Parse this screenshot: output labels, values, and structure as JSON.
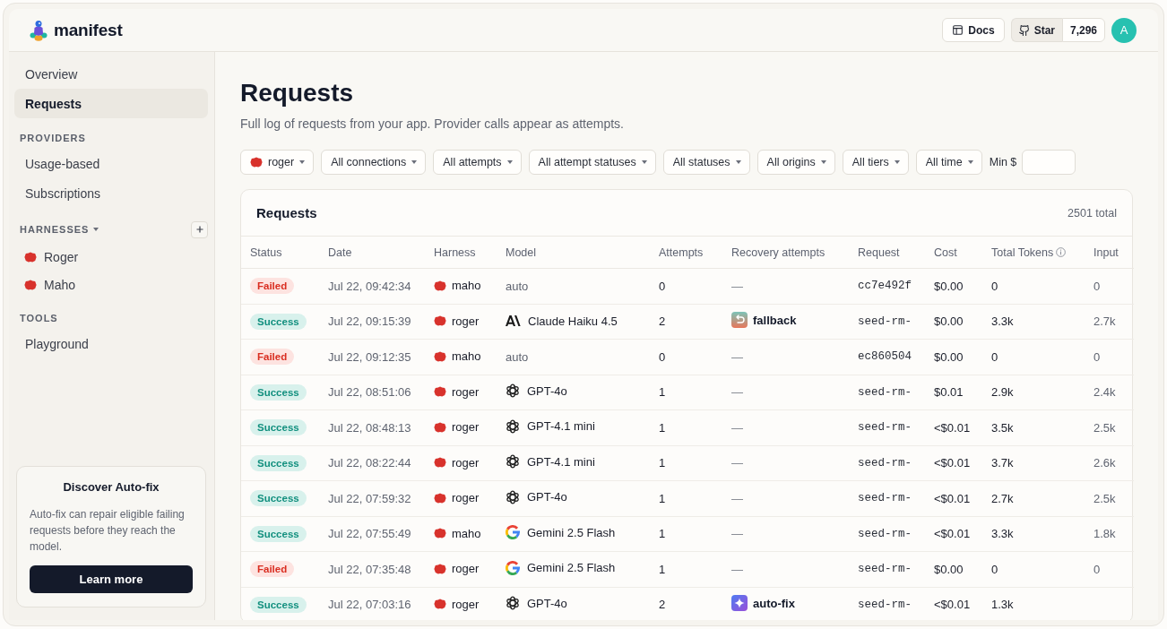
{
  "header": {
    "logo": "manifest",
    "docs": "Docs",
    "star": "Star",
    "star_count": "7,296",
    "avatar": "A"
  },
  "sidebar": {
    "nav": [
      {
        "label": "Overview",
        "selected": false
      },
      {
        "label": "Requests",
        "selected": true
      }
    ],
    "sections": [
      {
        "title": "PROVIDERS",
        "kind": "plain",
        "items": [
          {
            "label": "Usage-based",
            "selected": false
          },
          {
            "label": "Subscriptions",
            "selected": false
          }
        ]
      },
      {
        "title": "HARNESSES",
        "kind": "harnesses",
        "items": [
          {
            "label": "Roger",
            "selected": false
          },
          {
            "label": "Maho",
            "selected": false
          }
        ]
      },
      {
        "title": "TOOLS",
        "kind": "plain",
        "items": [
          {
            "label": "Playground",
            "selected": false
          }
        ]
      }
    ],
    "promo": {
      "title": "Discover Auto-fix",
      "text": "Auto-fix can repair eligible failing requests before they reach the model.",
      "button": "Learn more"
    }
  },
  "page": {
    "title": "Requests",
    "subtitle": "Full log of requests from your app. Provider calls appear as attempts.",
    "filters": [
      {
        "label": "roger",
        "kind": "harness"
      },
      {
        "label": "All connections",
        "kind": "plain"
      },
      {
        "label": "All attempts",
        "kind": "plain"
      },
      {
        "label": "All attempt statuses",
        "kind": "plain"
      },
      {
        "label": "All statuses",
        "kind": "plain"
      },
      {
        "label": "All origins",
        "kind": "plain"
      },
      {
        "label": "All tiers",
        "kind": "plain"
      },
      {
        "label": "All time",
        "kind": "plain"
      }
    ],
    "min_cost": {
      "label": "Min $"
    }
  },
  "table": {
    "title": "Requests",
    "total": "2501 total",
    "columns": [
      {
        "label": "Status",
        "info": false
      },
      {
        "label": "Date",
        "info": false
      },
      {
        "label": "Harness",
        "info": false
      },
      {
        "label": "Model",
        "info": false
      },
      {
        "label": "Attempts",
        "info": false
      },
      {
        "label": "Recovery attempts",
        "info": false
      },
      {
        "label": "Request",
        "info": false
      },
      {
        "label": "Cost",
        "info": false
      },
      {
        "label": "Total Tokens",
        "info": true
      },
      {
        "label": "Input",
        "info": false
      }
    ],
    "rows": [
      {
        "status": {
          "label": "Failed",
          "kind": "failed"
        },
        "date": "Jul 22, 09:42:34",
        "harness": "maho",
        "model": {
          "name": "auto",
          "kind": "auto"
        },
        "attempts": "0",
        "recovery": {
          "label": "—",
          "kind": "none"
        },
        "request": "cc7e492f",
        "cost": "$0.00",
        "total_tokens": "0",
        "input": "0"
      },
      {
        "status": {
          "label": "Success",
          "kind": "success"
        },
        "date": "Jul 22, 09:15:39",
        "harness": "roger",
        "model": {
          "name": "Claude Haiku 4.5",
          "kind": "anthropic"
        },
        "attempts": "2",
        "recovery": {
          "label": "fallback",
          "kind": "fallback"
        },
        "request": "seed-rm-",
        "cost": "$0.00",
        "total_tokens": "3.3k",
        "input": "2.7k"
      },
      {
        "status": {
          "label": "Failed",
          "kind": "failed"
        },
        "date": "Jul 22, 09:12:35",
        "harness": "maho",
        "model": {
          "name": "auto",
          "kind": "auto"
        },
        "attempts": "0",
        "recovery": {
          "label": "—",
          "kind": "none"
        },
        "request": "ec860504",
        "cost": "$0.00",
        "total_tokens": "0",
        "input": "0"
      },
      {
        "status": {
          "label": "Success",
          "kind": "success"
        },
        "date": "Jul 22, 08:51:06",
        "harness": "roger",
        "model": {
          "name": "GPT-4o",
          "kind": "openai"
        },
        "attempts": "1",
        "recovery": {
          "label": "—",
          "kind": "none"
        },
        "request": "seed-rm-",
        "cost": "$0.01",
        "total_tokens": "2.9k",
        "input": "2.4k"
      },
      {
        "status": {
          "label": "Success",
          "kind": "success"
        },
        "date": "Jul 22, 08:48:13",
        "harness": "roger",
        "model": {
          "name": "GPT-4.1 mini",
          "kind": "openai"
        },
        "attempts": "1",
        "recovery": {
          "label": "—",
          "kind": "none"
        },
        "request": "seed-rm-",
        "cost": "<$0.01",
        "total_tokens": "3.5k",
        "input": "2.5k"
      },
      {
        "status": {
          "label": "Success",
          "kind": "success"
        },
        "date": "Jul 22, 08:22:44",
        "harness": "roger",
        "model": {
          "name": "GPT-4.1 mini",
          "kind": "openai"
        },
        "attempts": "1",
        "recovery": {
          "label": "—",
          "kind": "none"
        },
        "request": "seed-rm-",
        "cost": "<$0.01",
        "total_tokens": "3.7k",
        "input": "2.6k"
      },
      {
        "status": {
          "label": "Success",
          "kind": "success"
        },
        "date": "Jul 22, 07:59:32",
        "harness": "roger",
        "model": {
          "name": "GPT-4o",
          "kind": "openai"
        },
        "attempts": "1",
        "recovery": {
          "label": "—",
          "kind": "none"
        },
        "request": "seed-rm-",
        "cost": "<$0.01",
        "total_tokens": "2.7k",
        "input": "2.5k"
      },
      {
        "status": {
          "label": "Success",
          "kind": "success"
        },
        "date": "Jul 22, 07:55:49",
        "harness": "maho",
        "model": {
          "name": "Gemini 2.5 Flash",
          "kind": "google"
        },
        "attempts": "1",
        "recovery": {
          "label": "—",
          "kind": "none"
        },
        "request": "seed-rm-",
        "cost": "<$0.01",
        "total_tokens": "3.3k",
        "input": "1.8k"
      },
      {
        "status": {
          "label": "Failed",
          "kind": "failed"
        },
        "date": "Jul 22, 07:35:48",
        "harness": "roger",
        "model": {
          "name": "Gemini 2.5 Flash",
          "kind": "google"
        },
        "attempts": "1",
        "recovery": {
          "label": "—",
          "kind": "none"
        },
        "request": "seed-rm-",
        "cost": "$0.00",
        "total_tokens": "0",
        "input": "0"
      },
      {
        "status": {
          "label": "Success",
          "kind": "success"
        },
        "date": "Jul 22, 07:03:16",
        "harness": "roger",
        "model": {
          "name": "GPT-4o",
          "kind": "openai"
        },
        "attempts": "2",
        "recovery": {
          "label": "auto-fix",
          "kind": "autofix"
        },
        "request": "seed-rm-",
        "cost": "<$0.01",
        "total_tokens": "1.3k"
      }
    ]
  }
}
